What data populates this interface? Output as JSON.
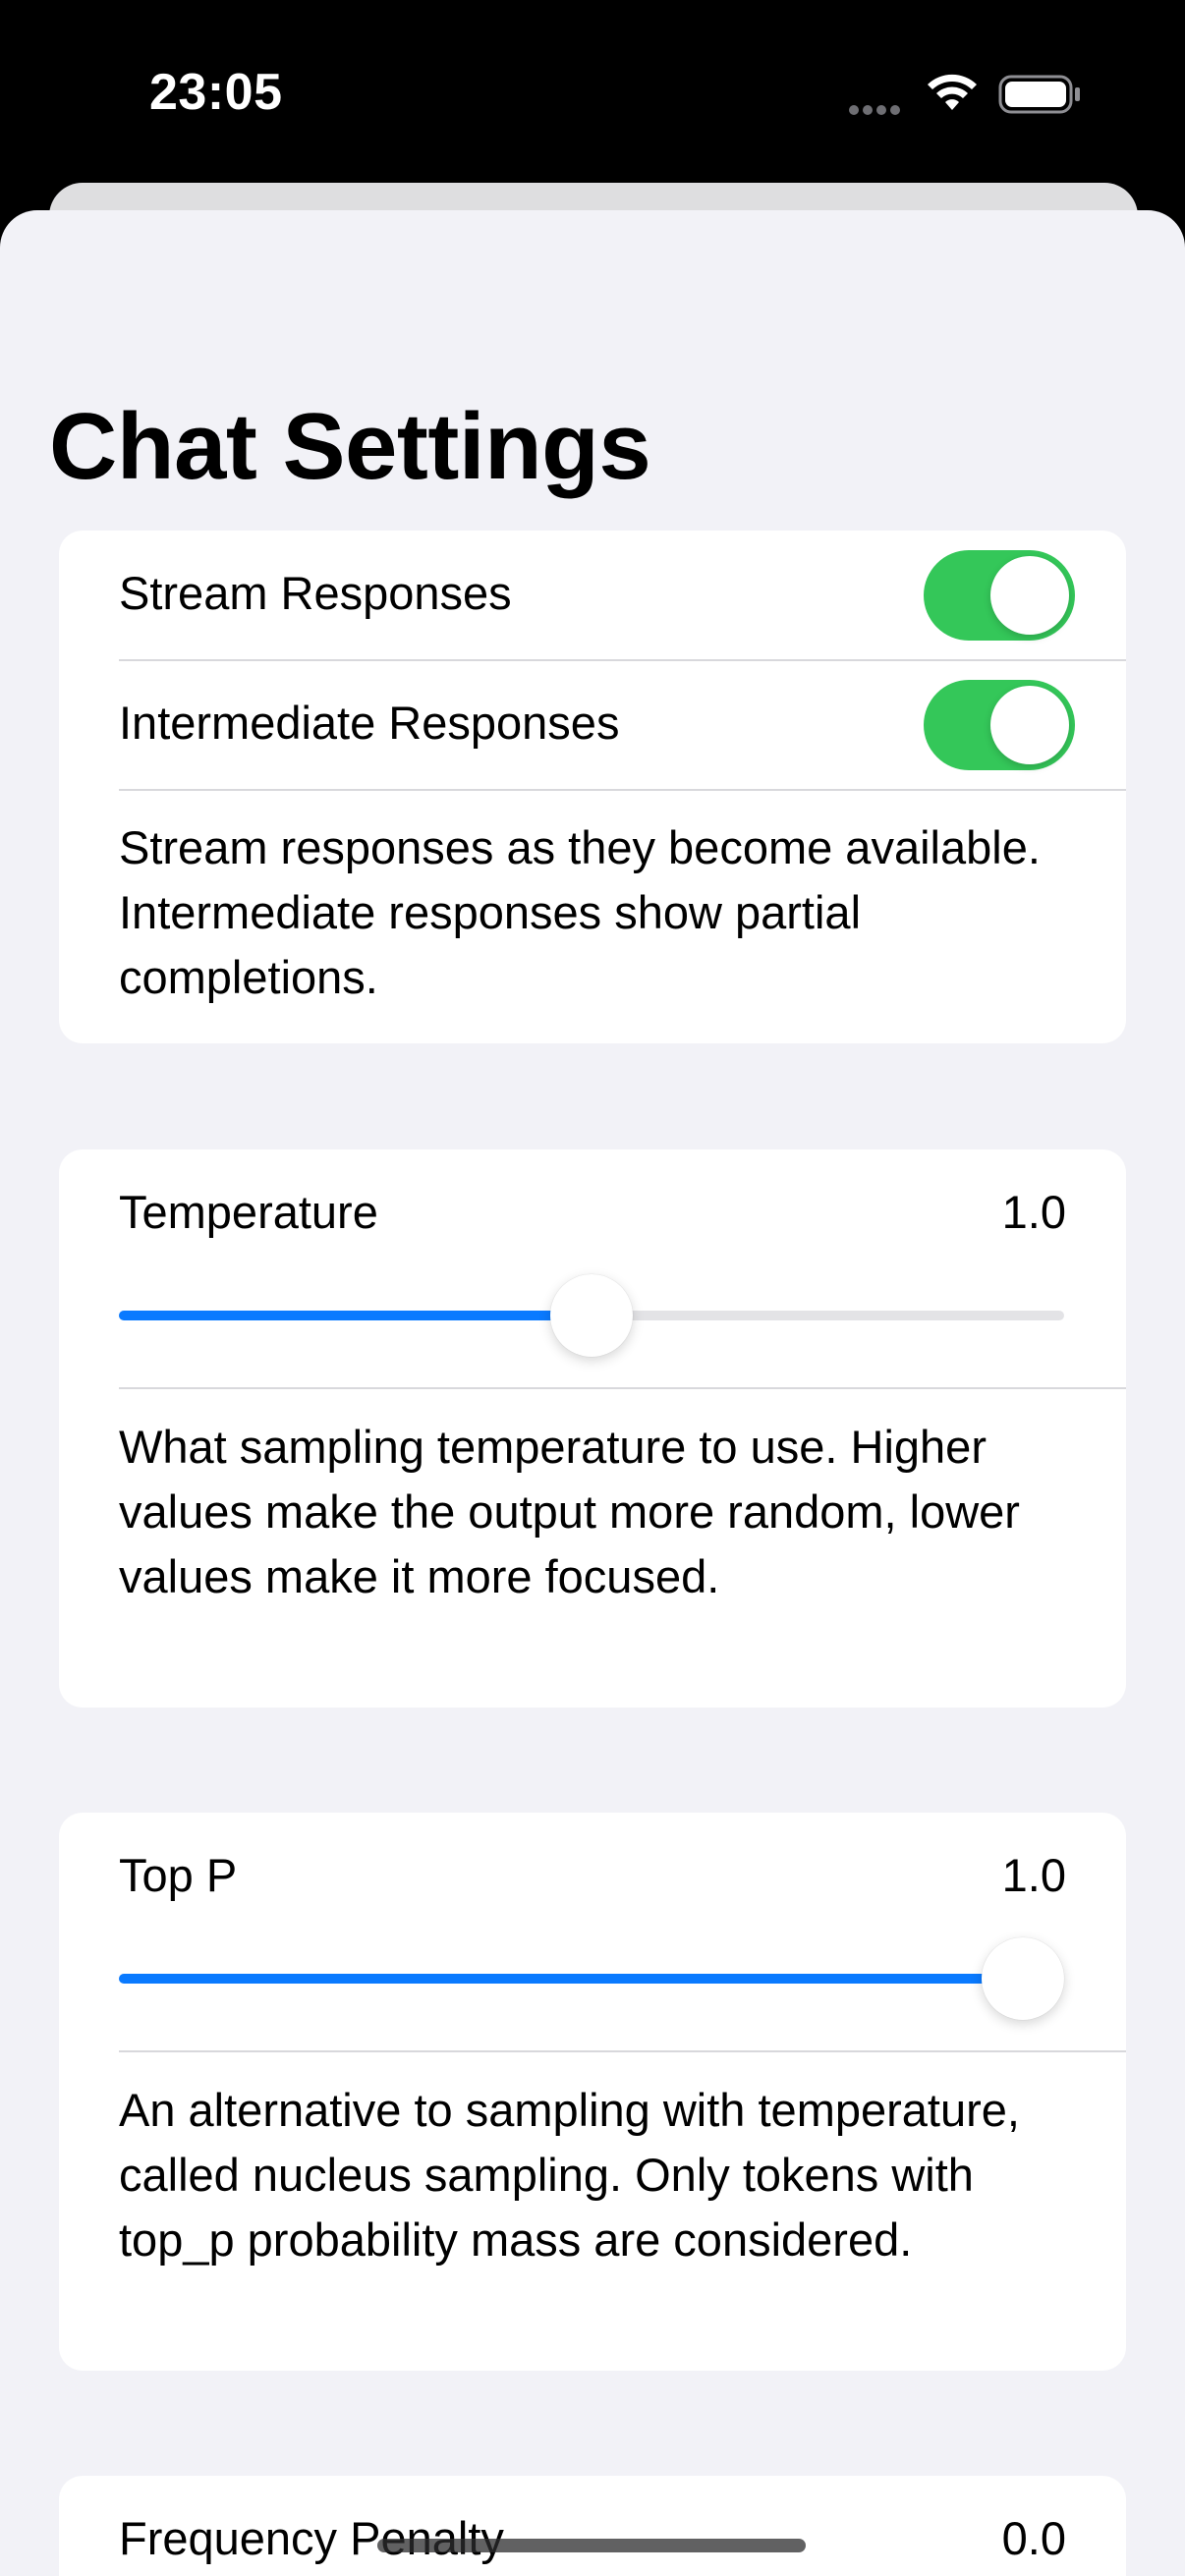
{
  "status_bar": {
    "time": "23:05",
    "icons": [
      "signal-dots-icon",
      "wifi-icon",
      "battery-icon"
    ]
  },
  "page": {
    "title": "Chat Settings"
  },
  "streaming": {
    "stream_label": "Stream Responses",
    "stream_enabled": true,
    "intermediate_label": "Intermediate Responses",
    "intermediate_enabled": true,
    "footnote": "Stream responses as they become available. Intermediate responses show partial completions."
  },
  "temperature": {
    "label": "Temperature",
    "value": "1.0",
    "slider_fraction": 0.5,
    "footnote": "What sampling temperature to use. Higher values make the output more random, lower values make it more focused."
  },
  "top_p": {
    "label": "Top P",
    "value": "1.0",
    "slider_fraction": 1.0,
    "footnote": "An alternative to sampling with temperature, called nucleus sampling. Only tokens with top_p probability mass are considered."
  },
  "frequency_penalty": {
    "label": "Frequency Penalty",
    "value": "0.0"
  },
  "colors": {
    "toggle_on": "#34c759",
    "slider_accent": "#0a7aff",
    "background": "#f2f2f7",
    "card": "#ffffff"
  }
}
